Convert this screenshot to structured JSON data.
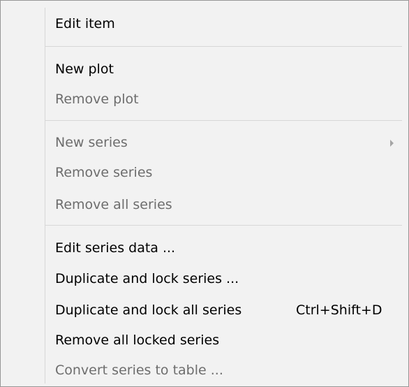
{
  "menu": {
    "items": [
      {
        "label": "Edit item",
        "enabled": true
      },
      {
        "label": "New plot",
        "enabled": true
      },
      {
        "label": "Remove plot",
        "enabled": false
      },
      {
        "label": "New series",
        "enabled": false,
        "submenu": true
      },
      {
        "label": "Remove series",
        "enabled": false
      },
      {
        "label": "Remove all series",
        "enabled": false
      },
      {
        "label": "Edit series data ...",
        "enabled": true
      },
      {
        "label": "Duplicate and lock series ...",
        "enabled": true
      },
      {
        "label": "Duplicate and lock all series",
        "enabled": true,
        "shortcut": "Ctrl+Shift+D"
      },
      {
        "label": "Remove all locked series",
        "enabled": true
      },
      {
        "label": "Convert series to table ...",
        "enabled": false
      }
    ]
  },
  "colors": {
    "menu_background": "#f2f2f2",
    "disabled_text": "#6d6d6d",
    "separator": "#d7d7d7",
    "border": "#979797"
  }
}
